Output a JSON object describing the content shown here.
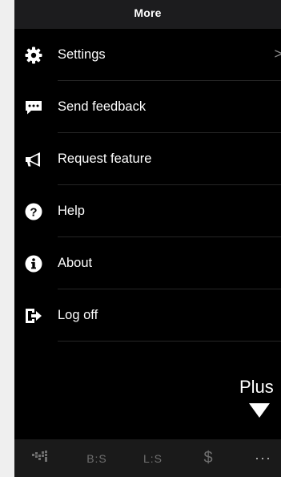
{
  "header": {
    "title": "More"
  },
  "menu": {
    "items": [
      {
        "label": "Settings",
        "icon": "gear-icon"
      },
      {
        "label": "Send feedback",
        "icon": "chat-bubble-icon"
      },
      {
        "label": "Request feature",
        "icon": "megaphone-icon"
      },
      {
        "label": "Help",
        "icon": "question-circle-icon"
      },
      {
        "label": "About",
        "icon": "info-circle-icon"
      },
      {
        "label": "Log off",
        "icon": "sign-out-icon"
      }
    ]
  },
  "annotation": {
    "label": "Plus"
  },
  "tabbar": {
    "tabs": [
      {
        "label": "",
        "icon": "dashboard-icon"
      },
      {
        "label": "B:S"
      },
      {
        "label": "L:S"
      },
      {
        "label": "$",
        "icon": "dollar-icon"
      },
      {
        "label": "···",
        "icon": "more-dots-icon"
      }
    ]
  },
  "colors": {
    "background": "#000000",
    "header": "#1c1c1e",
    "tabbar": "#1a1a1a",
    "text": "#ffffff",
    "tab_inactive": "#6f6f6f"
  }
}
